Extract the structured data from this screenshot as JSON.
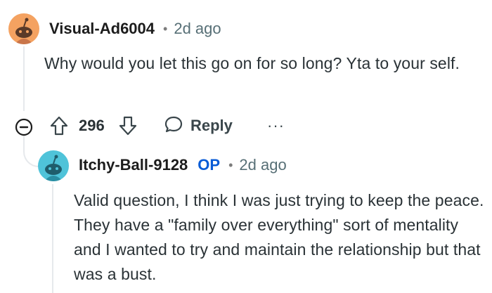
{
  "comment": {
    "username": "Visual-Ad6004",
    "separator": "•",
    "timestamp": "2d ago",
    "body": "Why would you let this go on for so long? Yta to your self.",
    "avatar_color": "#f4a261",
    "avatar_icon": "reddit-snoo-avatar",
    "actions": {
      "collapse_icon": "collapse-minus-icon",
      "upvote_icon": "upvote-arrow-icon",
      "vote_count": "296",
      "downvote_icon": "downvote-arrow-icon",
      "reply_icon": "speech-bubble-icon",
      "reply_label": "Reply",
      "more_label": "···"
    }
  },
  "reply": {
    "username": "Itchy-Ball-9128",
    "op_badge": "OP",
    "separator": "•",
    "timestamp": "2d ago",
    "body": "Valid question, I think I was just trying to keep the peace. They have a \"family over everything\" sort of mentality and I wanted to try and maintain the relationship but that was a bust.",
    "avatar_color": "#4fc3d9",
    "avatar_icon": "reddit-snoo-avatar"
  },
  "colors": {
    "op_badge": "#0a5cd6",
    "thread_line": "#e6e9ec",
    "meta_text": "#576f76"
  }
}
